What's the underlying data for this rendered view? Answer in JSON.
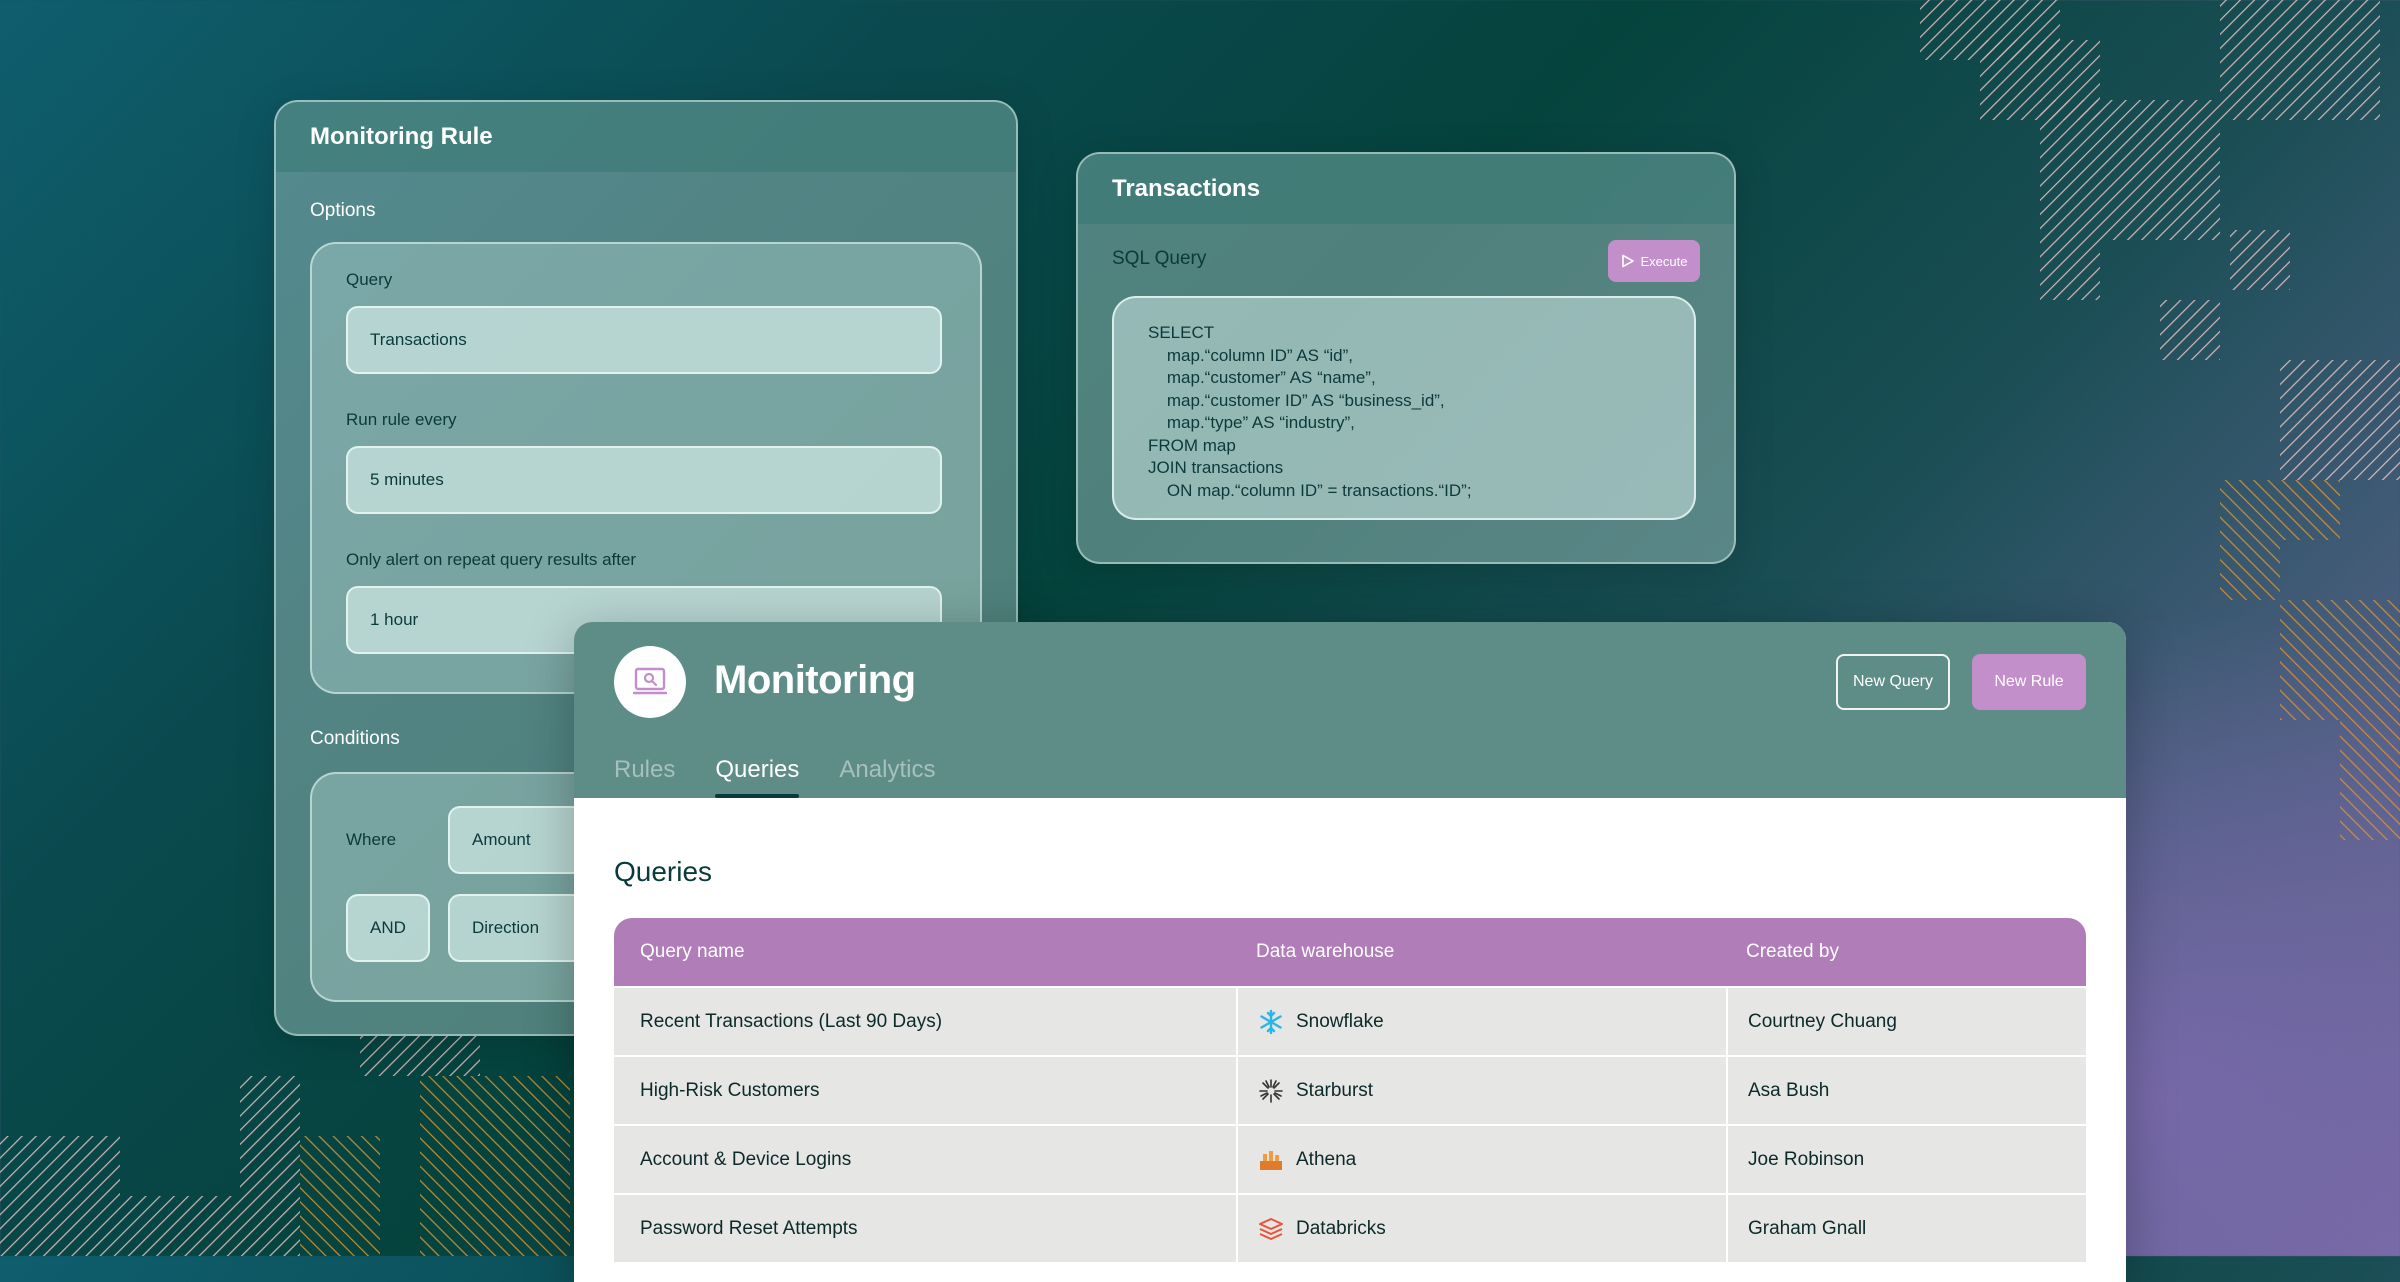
{
  "rule_card": {
    "title": "Monitoring Rule",
    "options_label": "Options",
    "fields": [
      {
        "label": "Query",
        "value": "Transactions"
      },
      {
        "label": "Run rule every",
        "value": "5 minutes"
      },
      {
        "label": "Only alert on repeat query results after",
        "value": "1 hour"
      }
    ],
    "conditions_label": "Conditions",
    "conditions": [
      {
        "operator": "Where",
        "field": "Amount"
      },
      {
        "operator": "AND",
        "field": "Direction"
      }
    ]
  },
  "transactions_card": {
    "title": "Transactions",
    "sql_label": "SQL Query",
    "execute_label": "Execute",
    "sql_lines": [
      "SELECT",
      "    map.“column ID” AS “id”,",
      "    map.“customer” AS “name”,",
      "    map.“customer ID” AS “business_id”,",
      "    map.“type” AS “industry”,",
      "FROM map",
      "JOIN transactions",
      "    ON map.“column ID” = transactions.“ID”;"
    ]
  },
  "main": {
    "title": "Monitoring",
    "new_query_label": "New Query",
    "new_rule_label": "New Rule",
    "tabs": [
      {
        "label": "Rules",
        "active": false
      },
      {
        "label": "Queries",
        "active": true
      },
      {
        "label": "Analytics",
        "active": false
      }
    ],
    "section_title": "Queries",
    "table": {
      "headers": [
        "Query name",
        "Data warehouse",
        "Created by"
      ],
      "rows": [
        {
          "name": "Recent Transactions (Last 90 Days)",
          "warehouse": "Snowflake",
          "icon": "snowflake-icon",
          "created_by": "Courtney Chuang"
        },
        {
          "name": "High-Risk Customers",
          "warehouse": "Starburst",
          "icon": "starburst-icon",
          "created_by": "Asa Bush"
        },
        {
          "name": "Account & Device Logins",
          "warehouse": "Athena",
          "icon": "athena-icon",
          "created_by": "Joe Robinson"
        },
        {
          "name": "Password Reset Attempts",
          "warehouse": "Databricks",
          "icon": "databricks-icon",
          "created_by": "Graham Gnall"
        }
      ]
    }
  },
  "colors": {
    "accent_purple": "#c38fcb",
    "table_header": "#b07db8",
    "header_teal": "#5e8c87",
    "pattern_orange": "#d8922f",
    "pattern_pink": "#ecc6c7"
  }
}
